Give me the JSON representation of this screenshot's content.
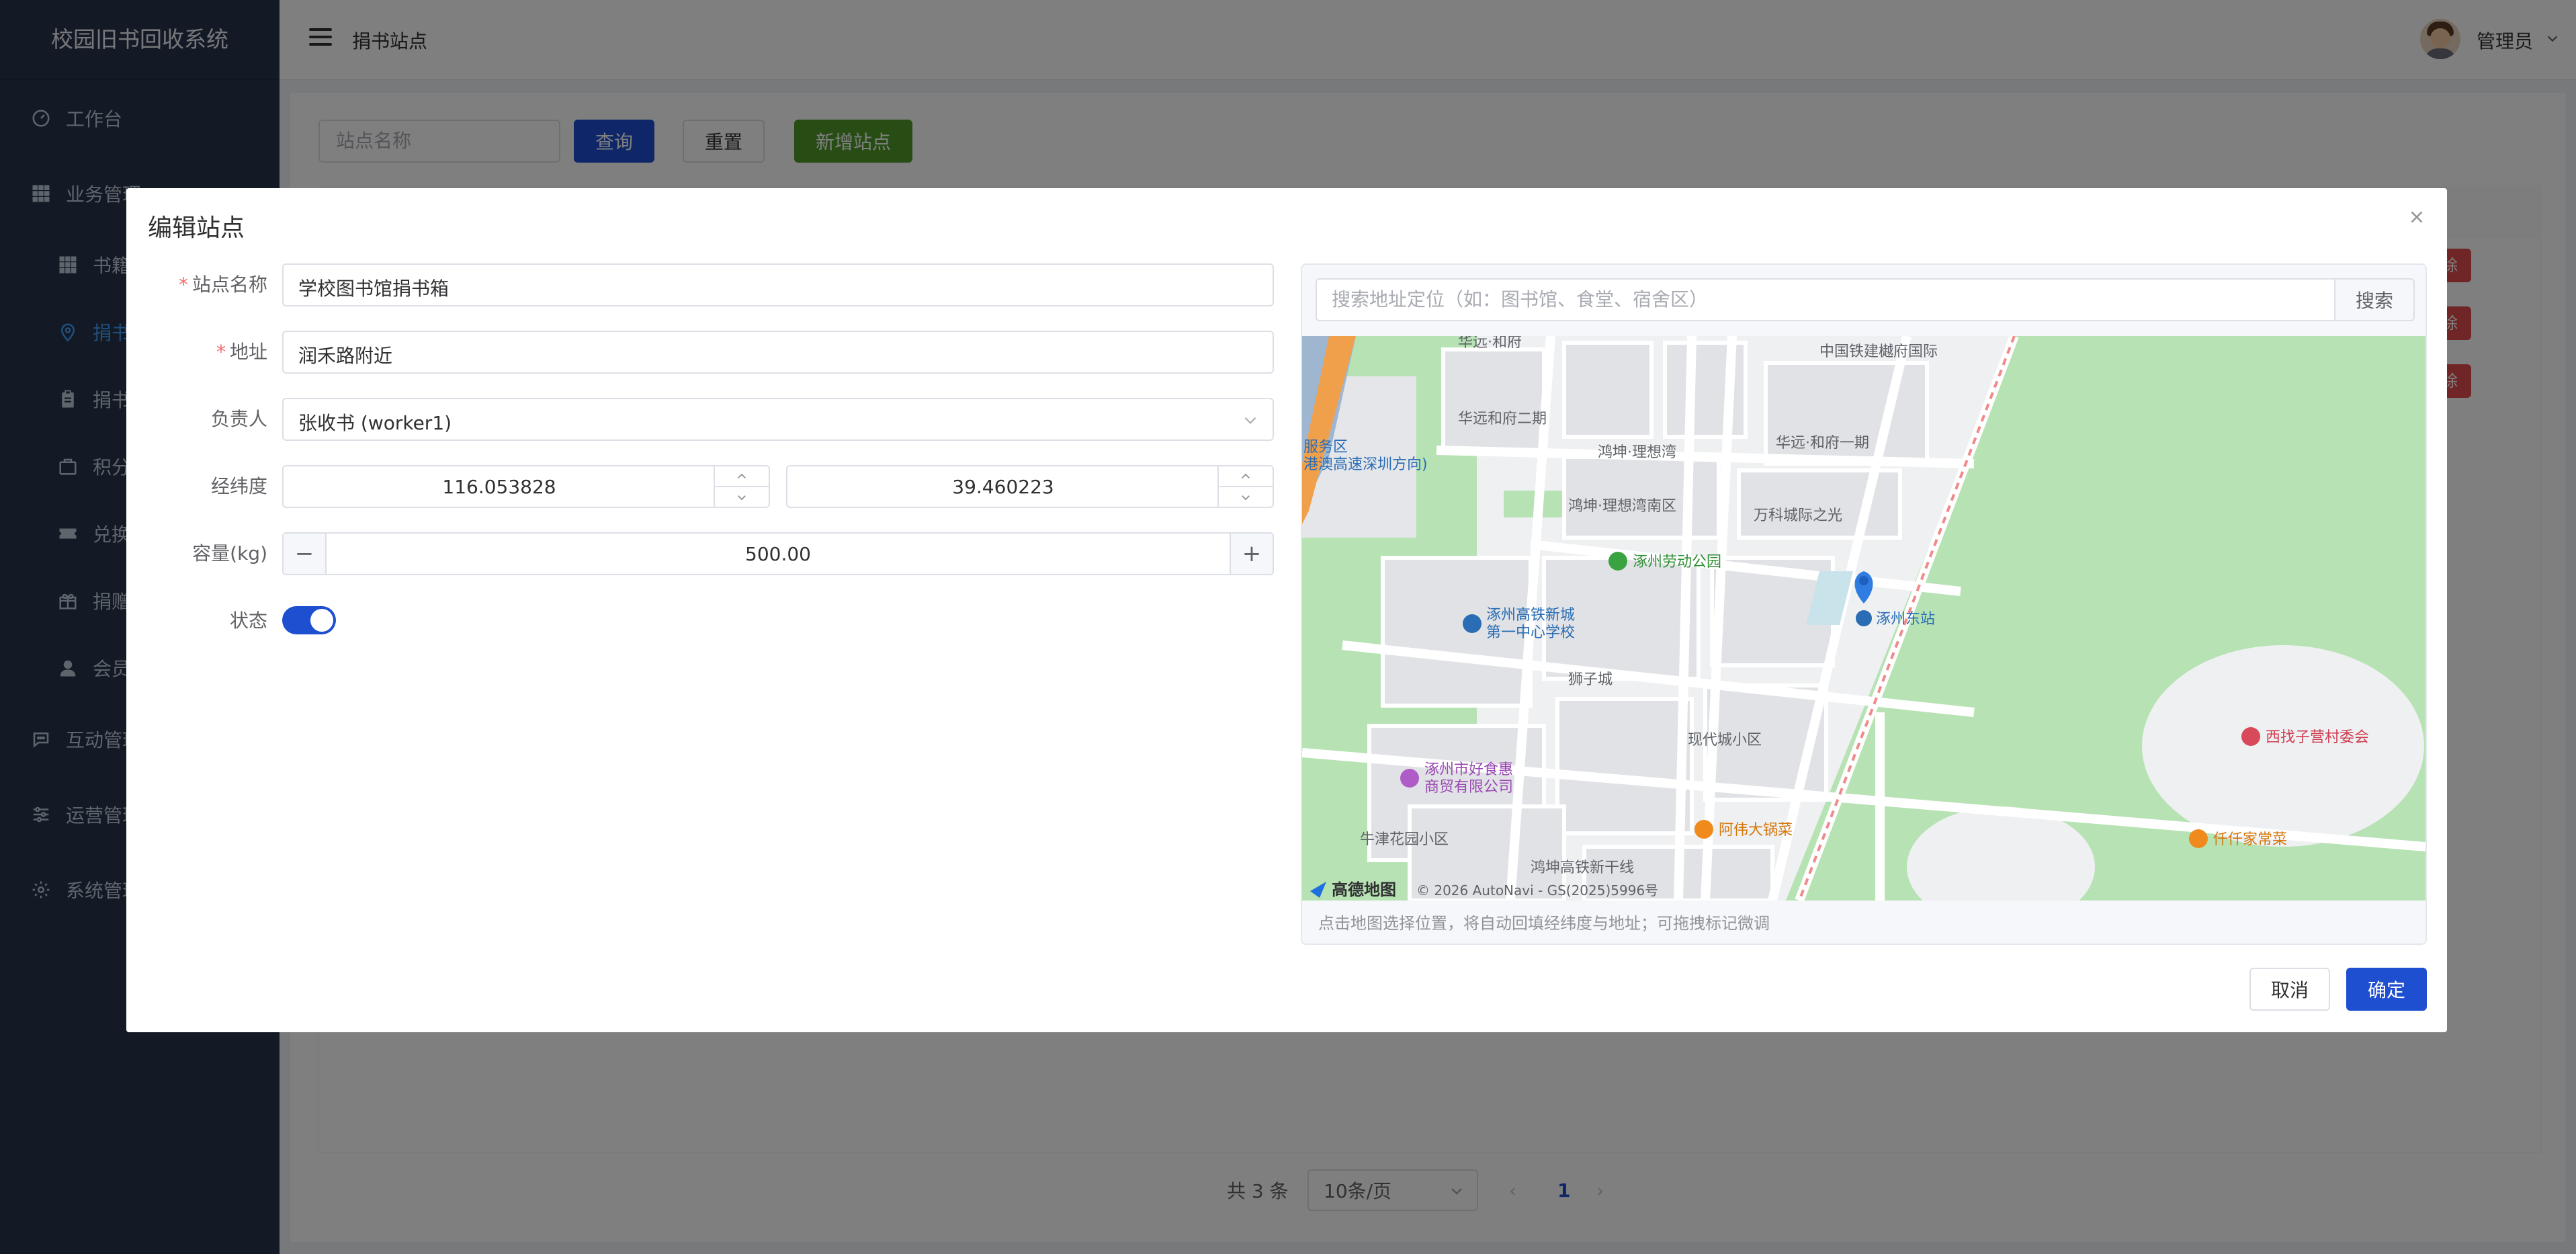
{
  "app": {
    "title": "校园旧书回收系统"
  },
  "sidebar": {
    "items": [
      {
        "label": "工作台",
        "icon": "dashboard-icon"
      },
      {
        "label": "业务管理",
        "icon": "grid-icon"
      },
      {
        "label": "书籍",
        "icon": "grid-icon"
      },
      {
        "label": "捐书",
        "icon": "location-icon",
        "active": true
      },
      {
        "label": "捐书",
        "icon": "clipboard-icon"
      },
      {
        "label": "积分",
        "icon": "bag-icon"
      },
      {
        "label": "兑换",
        "icon": "ticket-icon"
      },
      {
        "label": "捐赠",
        "icon": "gift-icon"
      },
      {
        "label": "会员",
        "icon": "user-icon"
      },
      {
        "label": "互动管理",
        "icon": "chat-icon"
      },
      {
        "label": "运营管理",
        "icon": "sliders-icon"
      },
      {
        "label": "系统管理",
        "icon": "gear-icon"
      }
    ]
  },
  "header": {
    "breadcrumb": "捐书站点",
    "username": "管理员"
  },
  "toolbar": {
    "search_placeholder": "站点名称",
    "query_label": "查询",
    "reset_label": "重置",
    "add_label": "新增站点"
  },
  "table": {
    "row_action_label": "除"
  },
  "pagination": {
    "total": "共 3 条",
    "page_size": "10条/页",
    "current_page": "1"
  },
  "dialog": {
    "title": "编辑站点",
    "fields": {
      "name_label": "站点名称",
      "name_value": "学校图书馆捐书箱",
      "address_label": "地址",
      "address_value": "润禾路附近",
      "manager_label": "负责人",
      "manager_value": "张收书 (worker1)",
      "lnglat_label": "经纬度",
      "lng_value": "116.053828",
      "lat_value": "39.460223",
      "capacity_label": "容量(kg)",
      "capacity_value": "500.00",
      "status_label": "状态",
      "status_on": true
    },
    "map": {
      "search_placeholder": "搜索地址定位（如：图书馆、食堂、宿舍区）",
      "search_button": "搜索",
      "hint": "点击地图选择位置，将自动回填经纬度与地址；可拖拽标记微调",
      "labels": {
        "huayuan_hefu": "华远·和府",
        "zhongtie": "中国铁建樾府国际",
        "huayuan_2": "华远和府二期",
        "hongkun": "鸿坤·理想湾",
        "huayuan_1": "华远·和府一期",
        "service1": "服务区",
        "service2": "港澳高速深圳方向)",
        "hongkun_south": "鸿坤·理想湾南区",
        "wanke": "万科城际之光",
        "park": "涿州劳动公园",
        "station": "涿州东站",
        "school1": "涿州高铁新城",
        "school2": "第一中心学校",
        "shizicheng": "狮子城",
        "xiandai": "现代城小区",
        "xizhaozi": "西找子营村委会",
        "haoshihui1": "涿州市好食惠",
        "haoshihui2": "商贸有限公司",
        "awei": "阿伟大锅菜",
        "qianqian": "仟仟家常菜",
        "niujin": "牛津花园小区",
        "gantie": "鸿坤高铁新干线",
        "logo": "高德地图",
        "copyright": "© 2026 AutoNavi - GS(2025)5996号"
      }
    },
    "cancel_label": "取消",
    "ok_label": "确定"
  },
  "colors": {
    "primary": "#1e4fd1",
    "success": "#4e9a2b",
    "danger": "#e04c4c",
    "sidebar": "#28354a"
  }
}
